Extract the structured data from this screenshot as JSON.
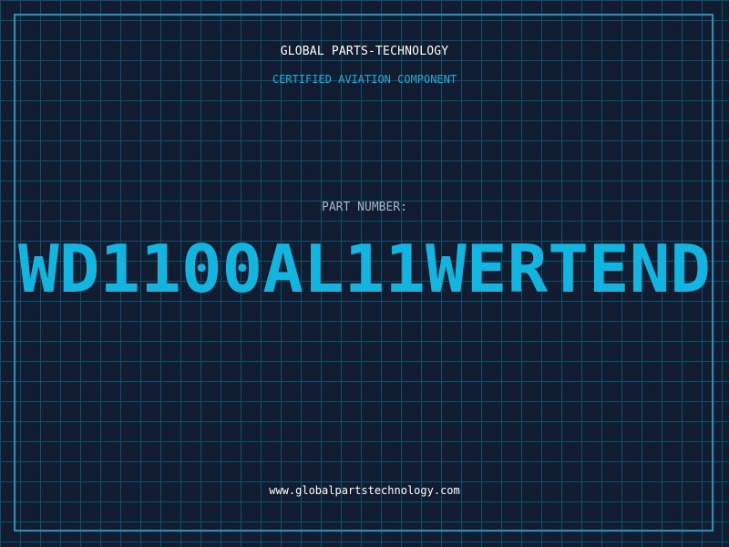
{
  "header": {
    "company": "GLOBAL PARTS-TECHNOLOGY",
    "subtitle": "CERTIFIED AVIATION COMPONENT"
  },
  "part": {
    "label": "PART NUMBER:",
    "number": "WD1100AL11WERTEND"
  },
  "footer": {
    "url": "www.globalpartstechnology.com"
  },
  "colors": {
    "background": "#111c30",
    "grid": "#1c4a62",
    "frame": "#1e93bf",
    "accent": "#21a9d4",
    "part_number": "#12b4e0",
    "label": "#a9b3c2",
    "text": "#ffffff"
  }
}
